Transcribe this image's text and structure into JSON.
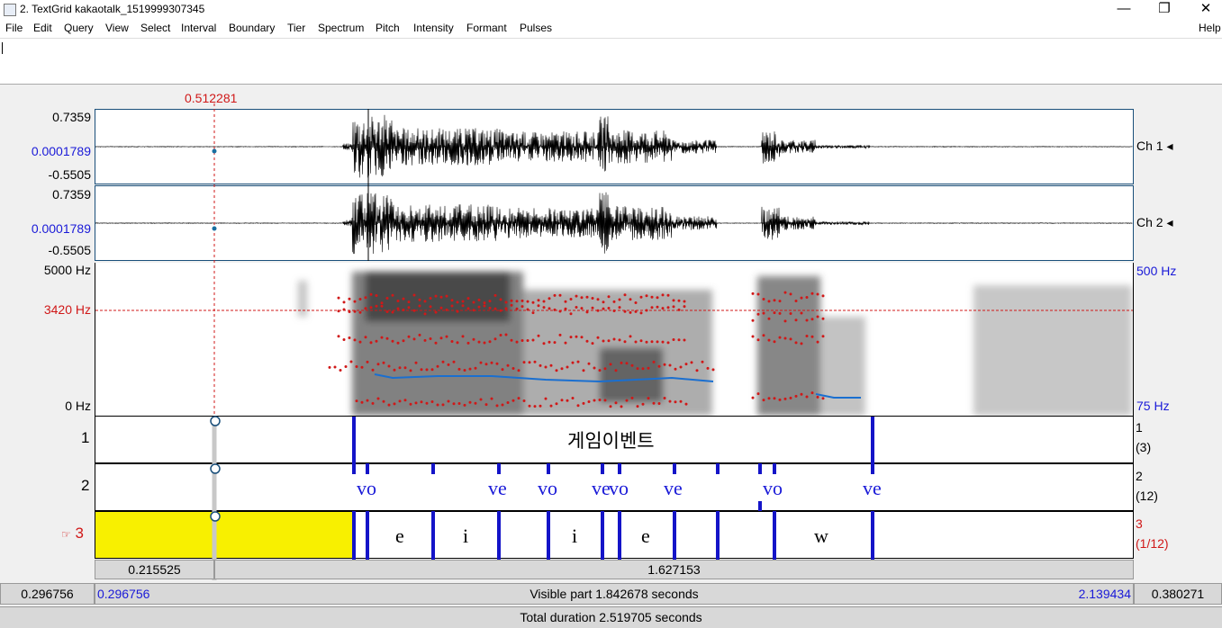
{
  "window": {
    "title": "2. TextGrid kakaotalk_1519999307345",
    "minimize": "—",
    "maximize": "❐",
    "close": "✕"
  },
  "menu": {
    "items": [
      "File",
      "Edit",
      "Query",
      "View",
      "Select",
      "Interval",
      "Boundary",
      "Tier",
      "Spectrum",
      "Pitch",
      "Intensity",
      "Formant",
      "Pulses"
    ],
    "help": "Help"
  },
  "cursor": {
    "time": "0.512281"
  },
  "channels": [
    {
      "max": "0.7359",
      "zero": "0.0001789",
      "min": "-0.5505",
      "label": "Ch 1",
      "arrow": "◂"
    },
    {
      "max": "0.7359",
      "zero": "0.0001789",
      "min": "-0.5505",
      "label": "Ch 2",
      "arrow": "◂"
    }
  ],
  "spectrogram": {
    "top_freq": "5000 Hz",
    "cursor_freq": "3420 Hz",
    "bottom_freq": "0 Hz",
    "pitch_top": "500 Hz",
    "pitch_bottom": "75 Hz"
  },
  "tiers": [
    {
      "number": "1",
      "count": "(3)",
      "intervals": [
        "게임이벤트"
      ]
    },
    {
      "number": "2",
      "count": "(12)",
      "points": [
        "vo",
        "ve",
        "vo",
        "ve",
        "vo",
        "ve",
        "vo",
        "ve"
      ]
    },
    {
      "number": "3",
      "pointer": "☞",
      "count": "(1/12)",
      "intervals": [
        "e",
        "i",
        "i",
        "e",
        "w"
      ]
    }
  ],
  "selection": {
    "left_duration": "0.215525",
    "right_duration": "1.627153"
  },
  "visible": {
    "left_outside": "0.296756",
    "start": "0.296756",
    "label": "Visible part 1.842678 seconds",
    "end": "2.139434",
    "right_outside": "0.380271"
  },
  "total": {
    "label": "Total duration 2.519705 seconds"
  },
  "colors": {
    "cursor": "#d01818",
    "boundary": "#1414c8",
    "selection": "#f8f000",
    "pitch": "#1a6fd0",
    "formant": "#d01818"
  }
}
